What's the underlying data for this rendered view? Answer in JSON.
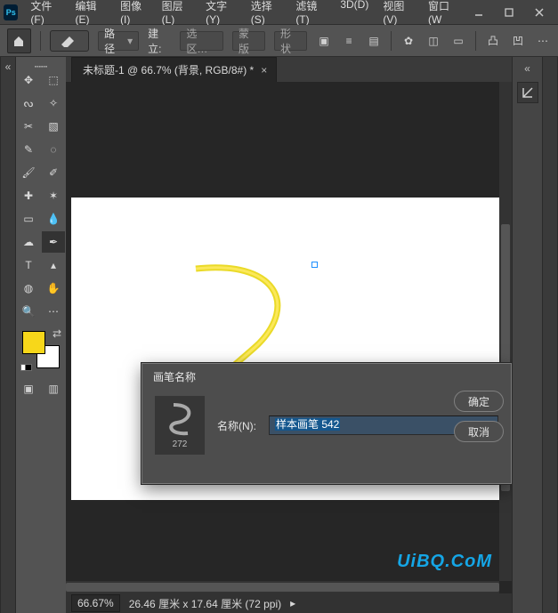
{
  "menu": {
    "items": [
      "文件(F)",
      "编辑(E)",
      "图像(I)",
      "图层(L)",
      "文字(Y)",
      "选择(S)",
      "滤镜(T)",
      "3D(D)",
      "视图(V)",
      "窗口(W"
    ]
  },
  "optionsbar": {
    "path_label": "路径",
    "make_label": "建立:",
    "sel_label": "选区…",
    "mask_label": "蒙版",
    "shape_label": "形状"
  },
  "doc_tab": {
    "title": "未标题-1 @ 66.7% (背景, RGB/8#) *",
    "close": "×"
  },
  "dialog": {
    "title": "画笔名称",
    "name_label": "名称(N):",
    "name_value": "样本画笔 542",
    "preview_size": "272",
    "ok": "确定",
    "cancel": "取消"
  },
  "status": {
    "zoom": "66.67%",
    "dims": "26.46 厘米 x 17.64 厘米 (72 ppi)"
  },
  "watermark": "UiBQ.CoM",
  "tools": [
    {
      "name": "move-tool",
      "glyph": "✥"
    },
    {
      "name": "artboard-tool",
      "glyph": "⬚"
    },
    {
      "name": "lasso-tool",
      "glyph": "ᔓ"
    },
    {
      "name": "magic-wand-tool",
      "glyph": "✧"
    },
    {
      "name": "crop-tool",
      "glyph": "✂"
    },
    {
      "name": "slice-tool",
      "glyph": "▧"
    },
    {
      "name": "eyedropper-tool",
      "glyph": "✎"
    },
    {
      "name": "marquee-tool",
      "glyph": "◌"
    },
    {
      "name": "brush-tool",
      "glyph": "🖌"
    },
    {
      "name": "pencil-tool",
      "glyph": "✐"
    },
    {
      "name": "healing-brush-tool",
      "glyph": "✚"
    },
    {
      "name": "stamp-tool",
      "glyph": "✶"
    },
    {
      "name": "gradient-tool",
      "glyph": "▭"
    },
    {
      "name": "blur-tool",
      "glyph": "💧"
    },
    {
      "name": "smudge-tool",
      "glyph": "☁"
    },
    {
      "name": "pen-tool",
      "glyph": "✒"
    },
    {
      "name": "text-tool",
      "glyph": "T"
    },
    {
      "name": "path-select-tool",
      "glyph": "▴"
    },
    {
      "name": "shape-tool",
      "glyph": "◍"
    },
    {
      "name": "hand-tool",
      "glyph": "✋"
    },
    {
      "name": "zoom-tool",
      "glyph": "🔍"
    },
    {
      "name": "edit-toolbar",
      "glyph": "⋯"
    }
  ]
}
